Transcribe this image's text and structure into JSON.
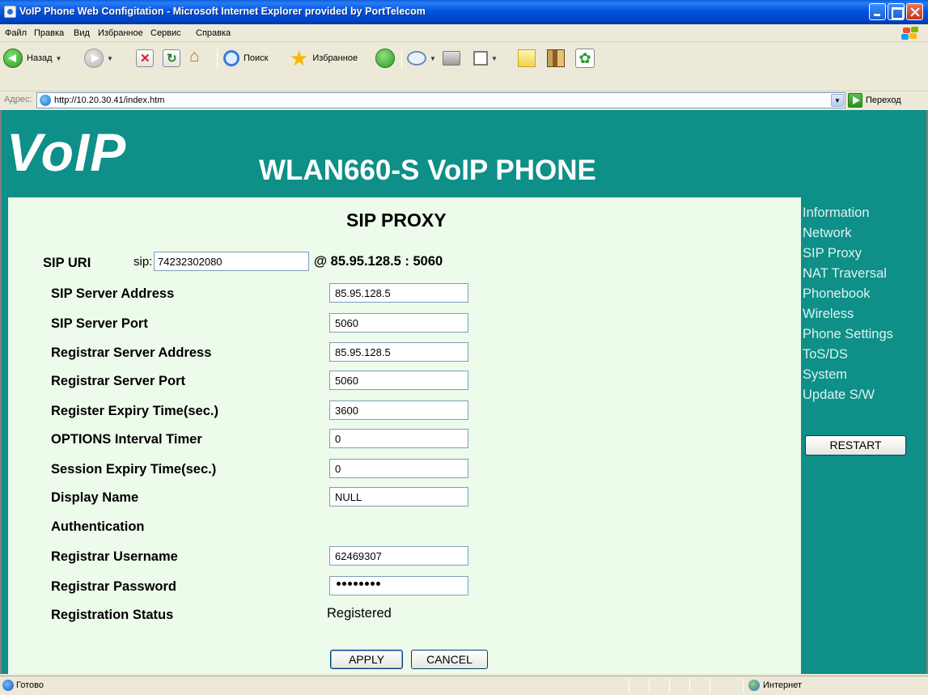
{
  "window": {
    "title": "VoIP Phone Web Configitation - Microsoft Internet Explorer provided by PortTelecom"
  },
  "menu": [
    "Файл",
    "Правка",
    "Вид",
    "Избранное",
    "Сервис",
    "Справка"
  ],
  "toolbar": {
    "back_label": "Назад",
    "search_label": "Поиск",
    "favorites_label": "Избранное"
  },
  "address": {
    "label": "Адрес:",
    "url": "http://10.20.30.41/index.htm",
    "go_label": "Переход"
  },
  "page": {
    "logo": "VoIP",
    "product_title": "WLAN660-S VoIP PHONE",
    "section_title": "SIP PROXY",
    "sip_uri": {
      "label": "SIP URI",
      "prefix": "sip:",
      "value": "74232302080",
      "host": "@ 85.95.128.5 : 5060"
    },
    "fields": [
      {
        "label": "SIP Server Address",
        "value": "85.95.128.5"
      },
      {
        "label": "SIP Server Port",
        "value": "5060"
      },
      {
        "label": "Registrar Server Address",
        "value": "85.95.128.5"
      },
      {
        "label": "Registrar Server Port",
        "value": "5060"
      },
      {
        "label": "Register Expiry Time(sec.)",
        "value": "3600"
      },
      {
        "label": "OPTIONS Interval Timer",
        "value": "0"
      },
      {
        "label": "Session Expiry Time(sec.)",
        "value": "0"
      },
      {
        "label": "Display Name",
        "value": "NULL"
      }
    ],
    "auth_heading": "Authentication",
    "username": {
      "label": "Registrar Username",
      "value": "62469307"
    },
    "password": {
      "label": "Registrar Password",
      "masked_length": 8
    },
    "status": {
      "label": "Registration Status",
      "value": "Registered"
    },
    "apply_label": "APPLY",
    "cancel_label": "CANCEL"
  },
  "sidebar": {
    "items": [
      "Information",
      "Network",
      "SIP Proxy",
      "NAT Traversal",
      "Phonebook",
      "Wireless",
      "Phone Settings",
      "ToS/DS",
      "System",
      "Update S/W"
    ],
    "restart_label": "RESTART"
  },
  "statusbar": {
    "left_text": "Готово",
    "zone_text": "Интернет"
  },
  "colors": {
    "page_teal": "#0E8F88",
    "content_bg": "#EDFBEA",
    "titlebar_blue": "#0054E3"
  }
}
